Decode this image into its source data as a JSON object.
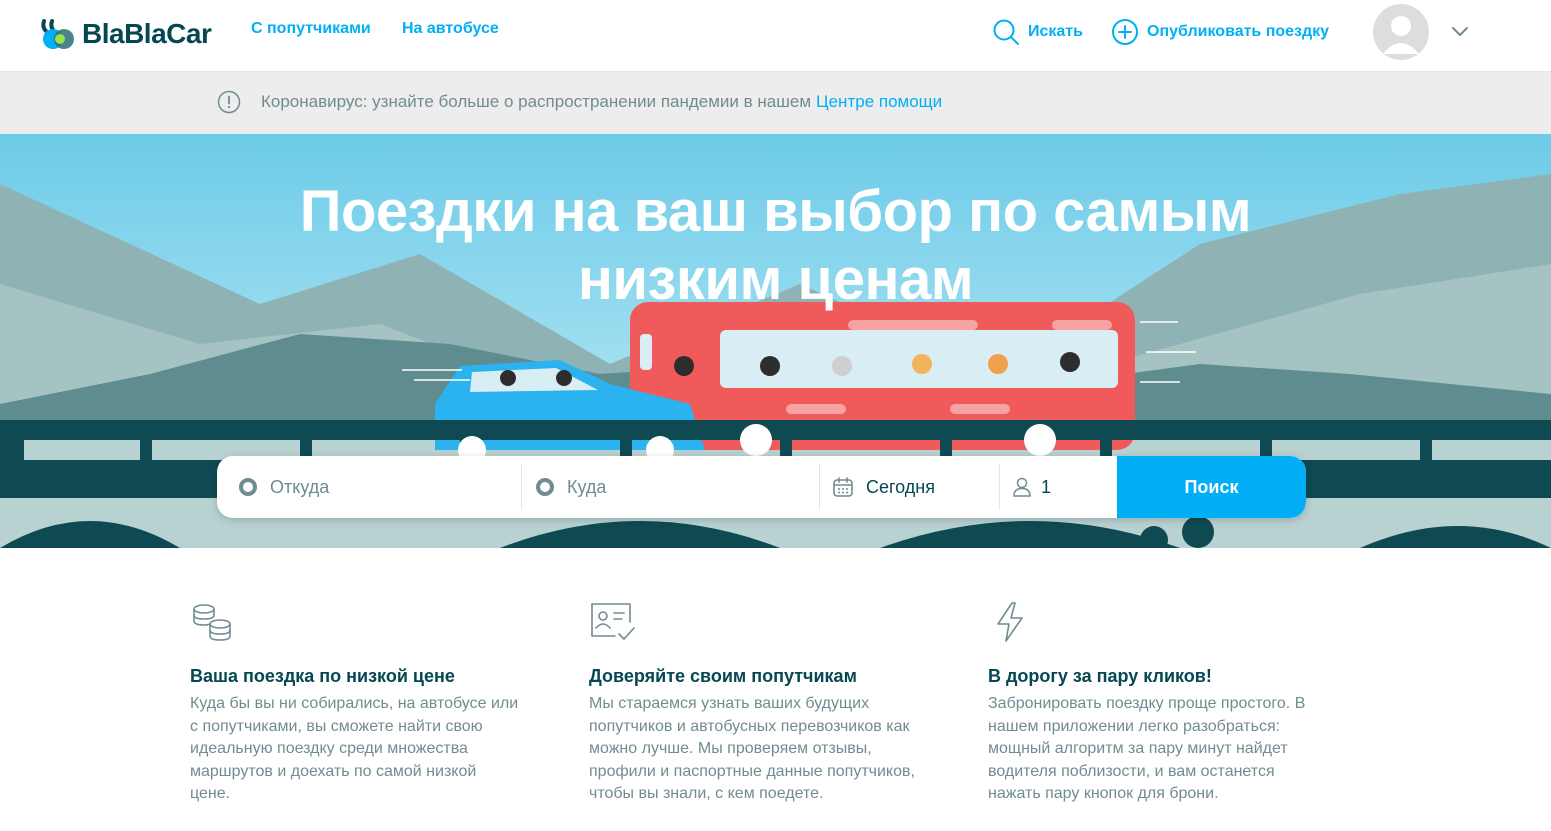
{
  "header": {
    "logo_text": "BlaBlaCar",
    "nav": [
      {
        "label": "С попутчиками"
      },
      {
        "label": "На автобусе"
      }
    ],
    "search_label": "Искать",
    "publish_label": "Опубликовать поездку",
    "icons": [
      "search-icon",
      "plus-circle-icon",
      "avatar-icon",
      "chevron-down-icon"
    ]
  },
  "notice": {
    "text": "Коронавирус: узнайте больше о распространении пандемии в нашем",
    "link": "Центре помощи",
    "icon": "info-icon"
  },
  "hero": {
    "title_line1": "Поездки на ваш выбор по самым",
    "title_line2": "низким ценам"
  },
  "search": {
    "from_placeholder": "Откуда",
    "to_placeholder": "Куда",
    "date_value": "Сегодня",
    "passengers_value": "1",
    "button_label": "Поиск"
  },
  "features": [
    {
      "icon": "coins-icon",
      "title": "Ваша поездка по низкой цене",
      "text": "Куда бы вы ни собирались, на автобусе или с попутчиками, вы сможете найти свою идеальную поездку среди множества маршрутов и доехать по самой низкой цене."
    },
    {
      "icon": "id-card-check-icon",
      "title": "Доверяйте своим попутчикам",
      "text": "Мы стараемся узнать ваших будущих попутчиков и автобусных перевозчиков как можно лучше. Мы проверяем отзывы, профили и паспортные данные попутчиков, чтобы вы знали, с кем поедете."
    },
    {
      "icon": "lightning-icon",
      "title": "В дорогу за пару кликов!",
      "text": "Забронировать поездку проще простого. В нашем приложении легко разобраться: мощный алгоритм за пару минут найдет водителя поблизости, и вам останется нажать пару кнопок для брони."
    }
  ],
  "colors": {
    "accent": "#00aff5",
    "text_dark": "#054752",
    "text_muted": "#708c91",
    "bus_red": "#f05a5a",
    "car_blue": "#2ab3ee"
  }
}
